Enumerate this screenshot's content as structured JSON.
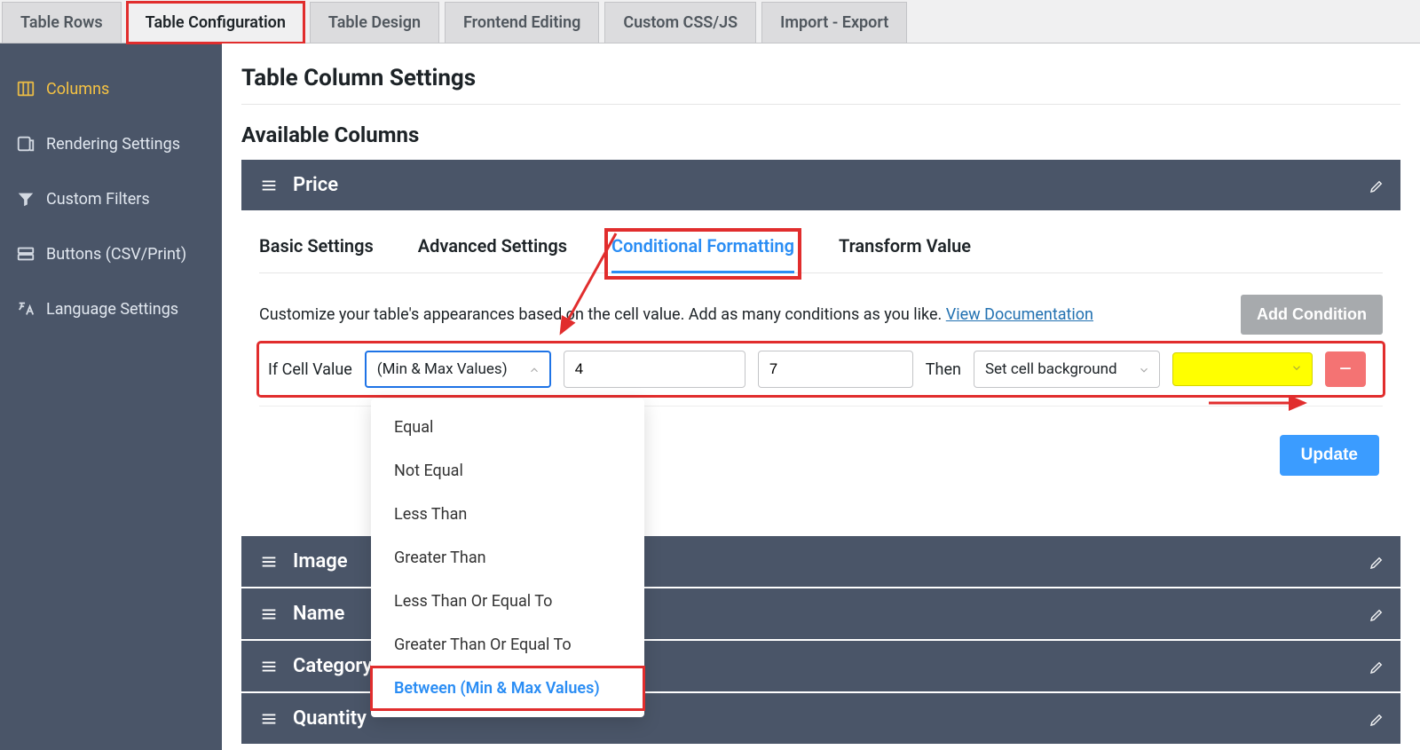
{
  "top_tabs": [
    "Table Rows",
    "Table Configuration",
    "Table Design",
    "Frontend Editing",
    "Custom CSS/JS",
    "Import - Export"
  ],
  "top_tabs_active_index": 1,
  "sidebar": {
    "items": [
      {
        "label": "Columns",
        "icon": "columns"
      },
      {
        "label": "Rendering Settings",
        "icon": "render"
      },
      {
        "label": "Custom Filters",
        "icon": "filter"
      },
      {
        "label": "Buttons (CSV/Print)",
        "icon": "buttons"
      },
      {
        "label": "Language Settings",
        "icon": "language"
      }
    ],
    "active_index": 0
  },
  "page": {
    "title": "Table Column Settings",
    "section_title": "Available Columns"
  },
  "open_column": {
    "name": "Price",
    "inner_tabs": [
      "Basic Settings",
      "Advanced Settings",
      "Conditional Formatting",
      "Transform Value"
    ],
    "inner_tabs_active_index": 2,
    "help_text_prefix": "Customize your table's appearances based on the cell value. Add as many conditions as you like. ",
    "help_link_text": "View Documentation",
    "add_condition_label": "Add Condition",
    "condition": {
      "if_label": "If Cell Value",
      "operator_display": "(Min & Max Values)",
      "min_value": "4",
      "max_value": "7",
      "then_label": "Then",
      "action_display": "Set cell background",
      "color_value": "#ffff00"
    },
    "operator_options": [
      "Equal",
      "Not Equal",
      "Less Than",
      "Greater Than",
      "Less Than Or Equal To",
      "Greater Than Or Equal To",
      "Between (Min & Max Values)"
    ],
    "operator_selected_index": 6,
    "update_label": "Update"
  },
  "other_columns": [
    "Image",
    "Name",
    "Category",
    "Quantity"
  ]
}
